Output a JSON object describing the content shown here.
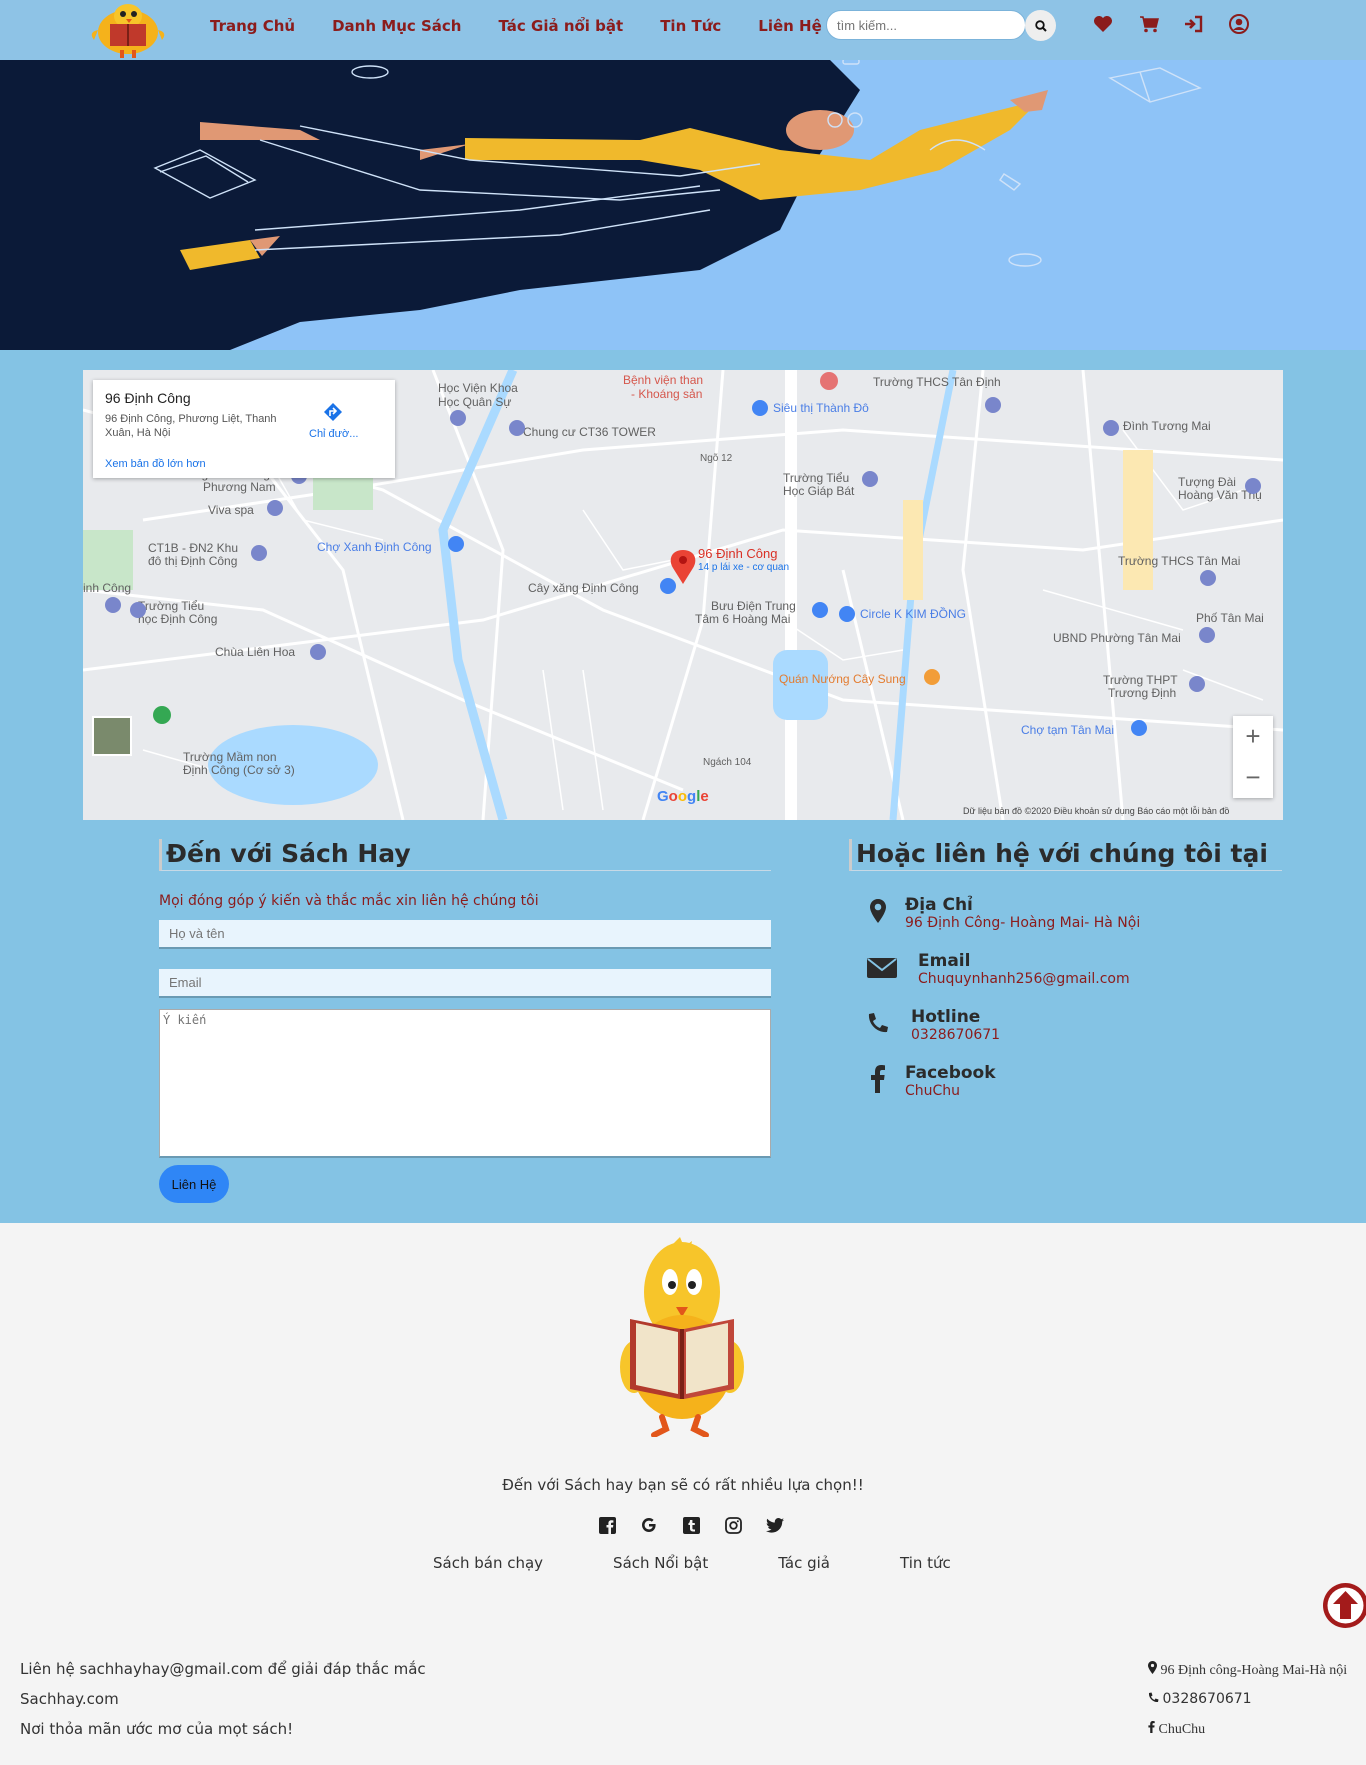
{
  "header": {
    "nav": [
      "Trang Chủ",
      "Danh Mục Sách",
      "Tác Giả nổi bật",
      "Tin Tức",
      "Liên Hệ"
    ],
    "search_placeholder": "tìm kiếm...",
    "icons": [
      "heart-icon",
      "cart-icon",
      "sign-in-icon",
      "user-icon"
    ]
  },
  "map": {
    "place_title": "96 Định Công",
    "place_address": "96 Định Công, Phương Liệt, Thanh Xuân, Hà Nội",
    "directions": "Chỉ đườ...",
    "larger_map": "Xem bản đồ lớn hơn",
    "pin_label": "96 Định Công",
    "pin_sub": "14 p lái xe - cơ quan",
    "footer": "Dữ liệu bản đồ ©2020    Điều khoản sử dụng    Báo cáo một lỗi bản đồ",
    "labels": [
      "Học Viện Khoa Học Quân Sự",
      "Bệnh viện than - Khoáng sản",
      "Trường THCS Tân Định",
      "Siêu thị Thành Đô",
      "Chung cư CT36 TOWER",
      "Đình Tương Mai",
      "Trường Phổ Thông Phương Nam",
      "Trường Tiểu Học Giáp Bát",
      "Tượng Đài Hoàng Văn Thụ",
      "Viva spa",
      "Chợ Xanh Định Công",
      "CT1B - ĐN2 Khu đô thị Định Công",
      "Cây xăng Định Công",
      "Bưu Điện Trung Tâm 6 Hoàng Mai",
      "Circle K KIM ĐỒNG",
      "Trường THCS Tân Mai",
      "Trường Tiểu học Định Công",
      "Chùa Liên Hoa",
      "Phố Tân Mai",
      "UBND Phường Tân Mai",
      "Quán Nướng Cây Sung",
      "Trường THPT Trương Định",
      "Chợ tạm Tân Mai",
      "Trường Mầm non Định Công"
    ]
  },
  "form": {
    "heading": "Đến với Sách Hay",
    "intro": "Mọi đóng góp ý kiến và thắc mắc xin liên hệ chúng tôi",
    "name_placeholder": "Họ và tên",
    "email_placeholder": "Email",
    "message_placeholder": "Ý kiến",
    "submit": "Liên Hệ"
  },
  "contact_info": {
    "heading": "Hoặc liên hệ với chúng tôi tại",
    "items": [
      {
        "title": "Địa Chỉ",
        "value": "96 Định Công- Hoàng Mai- Hà Nội",
        "icon": "map-marker-icon"
      },
      {
        "title": "Email",
        "value": "Chuquynhanh256@gmail.com",
        "icon": "envelope-icon"
      },
      {
        "title": "Hotline",
        "value": "0328670671",
        "icon": "phone-icon"
      },
      {
        "title": "Facebook",
        "value": "ChuChu",
        "icon": "facebook-icon"
      }
    ]
  },
  "footer": {
    "tagline": "Đến với Sách hay bạn sẽ có rất nhiều lựa chọn!!",
    "social": [
      "facebook-square-icon",
      "google-icon",
      "tumblr-icon",
      "instagram-icon",
      "twitter-icon"
    ],
    "links": [
      "Sách bán chạy",
      "Sách Nổi bật",
      "Tác giả",
      "Tin tức"
    ],
    "left_lines": [
      "Liên hệ sachhayhay@gmail.com để giải đáp thắc mắc",
      "Sachhay.com",
      "Nơi thỏa mãn ước mơ của mọt sách!"
    ],
    "right_lines": [
      "96 Định công-Hoàng Mai-Hà nội",
      "0328670671",
      "ChuChu"
    ]
  },
  "colors": {
    "accent": "#8b1c1c",
    "header_bg": "#8ec3e6",
    "contact_bg": "#84c3e4",
    "button": "#2f86f6"
  }
}
